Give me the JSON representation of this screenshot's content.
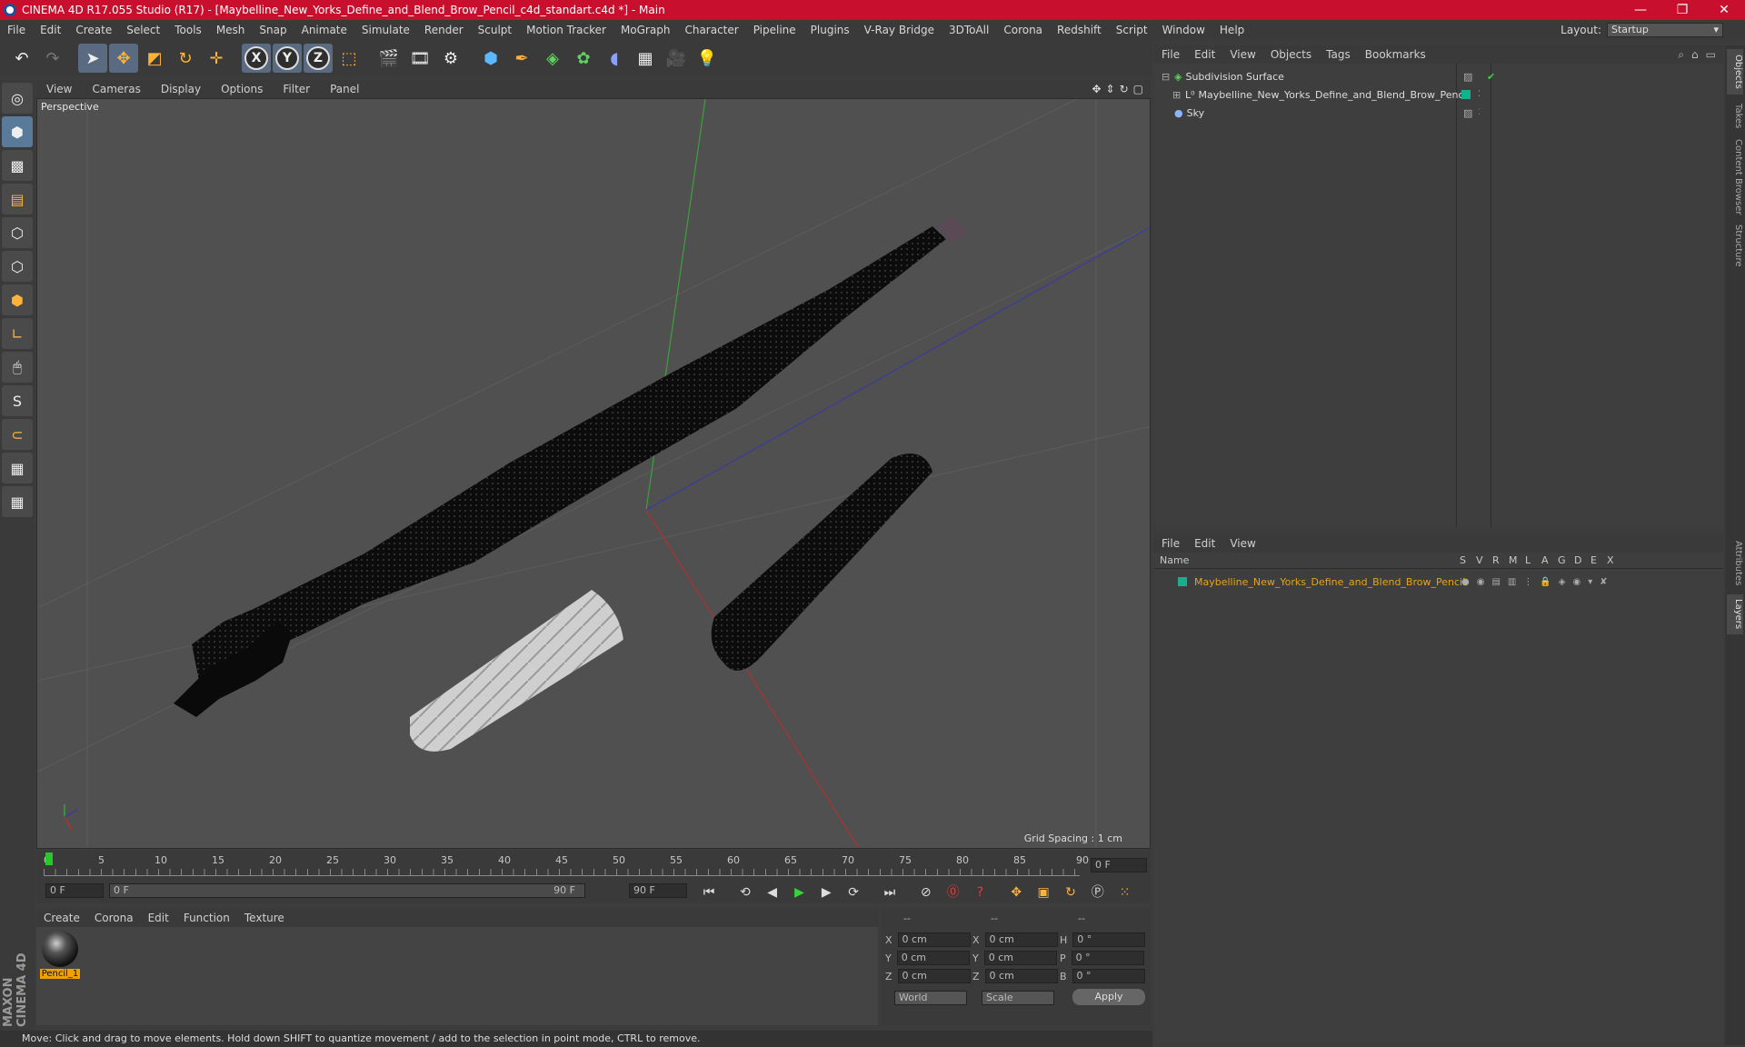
{
  "window": {
    "title": "CINEMA 4D R17.055 Studio (R17) - [Maybelline_New_Yorks_Define_and_Blend_Brow_Pencil_c4d_standart.c4d *] - Main",
    "min_glyph": "—",
    "max_glyph": "❐",
    "close_glyph": "✕"
  },
  "menubar": {
    "items": [
      "File",
      "Edit",
      "Create",
      "Select",
      "Tools",
      "Mesh",
      "Snap",
      "Animate",
      "Simulate",
      "Render",
      "Sculpt",
      "Motion Tracker",
      "MoGraph",
      "Character",
      "Pipeline",
      "Plugins",
      "V-Ray Bridge",
      "3DToAll",
      "Corona",
      "Redshift",
      "Script",
      "Window",
      "Help"
    ],
    "layout_label": "Layout:",
    "layout_value": "Startup"
  },
  "viewport": {
    "menu": [
      "View",
      "Cameras",
      "Display",
      "Options",
      "Filter",
      "Panel"
    ],
    "camera_label": "Perspective",
    "grid_spacing": "Grid Spacing : 1 cm"
  },
  "timeline": {
    "ticks": [
      "0",
      "5",
      "10",
      "15",
      "20",
      "25",
      "30",
      "35",
      "40",
      "45",
      "50",
      "55",
      "60",
      "65",
      "70",
      "75",
      "80",
      "85",
      "90"
    ],
    "end_field": "0 F",
    "start_field": "0 F",
    "range_start": "0 F",
    "range_end": "90 F",
    "max_field": "90 F"
  },
  "material_manager": {
    "menu": [
      "Create",
      "Corona",
      "Edit",
      "Function",
      "Texture"
    ],
    "materials": [
      {
        "name": "Pencil_1"
      }
    ]
  },
  "coordinates": {
    "header": [
      "--",
      "--",
      "--"
    ],
    "rows": [
      {
        "a": "X",
        "av": "0 cm",
        "b": "X",
        "bv": "0 cm",
        "c": "H",
        "cv": "0 °"
      },
      {
        "a": "Y",
        "av": "0 cm",
        "b": "Y",
        "bv": "0 cm",
        "c": "P",
        "cv": "0 °"
      },
      {
        "a": "Z",
        "av": "0 cm",
        "b": "Z",
        "bv": "0 cm",
        "c": "B",
        "cv": "0 °"
      }
    ],
    "mode": "World",
    "transform": "Scale",
    "apply_label": "Apply"
  },
  "status": {
    "text": "Move: Click and drag to move elements. Hold down SHIFT to quantize movement / add to the selection in point mode, CTRL to remove."
  },
  "object_manager": {
    "menu": [
      "File",
      "Edit",
      "View",
      "Objects",
      "Tags",
      "Bookmarks"
    ],
    "objects": [
      {
        "name": "Subdivision Surface"
      },
      {
        "name": "Maybelline_New_Yorks_Define_and_Blend_Brow_Pencil"
      },
      {
        "name": "Sky"
      }
    ]
  },
  "layer_manager": {
    "menu": [
      "File",
      "Edit",
      "View"
    ],
    "columns": [
      "Name",
      "S",
      "V",
      "R",
      "M",
      "L",
      "A",
      "G",
      "D",
      "E",
      "X"
    ],
    "layers": [
      {
        "name": "Maybelline_New_Yorks_Define_and_Blend_Brow_Pencil",
        "color": "#17b08c"
      }
    ]
  },
  "side_tabs": [
    "Objects",
    "Takes",
    "Content Browser",
    "Structure",
    "Attributes",
    "Layers"
  ],
  "branding": "MAXON CINEMA 4D",
  "colors": {
    "titlebar": "#c8102e",
    "accent": "#17b08c",
    "layer_text": "#e8a21a"
  }
}
